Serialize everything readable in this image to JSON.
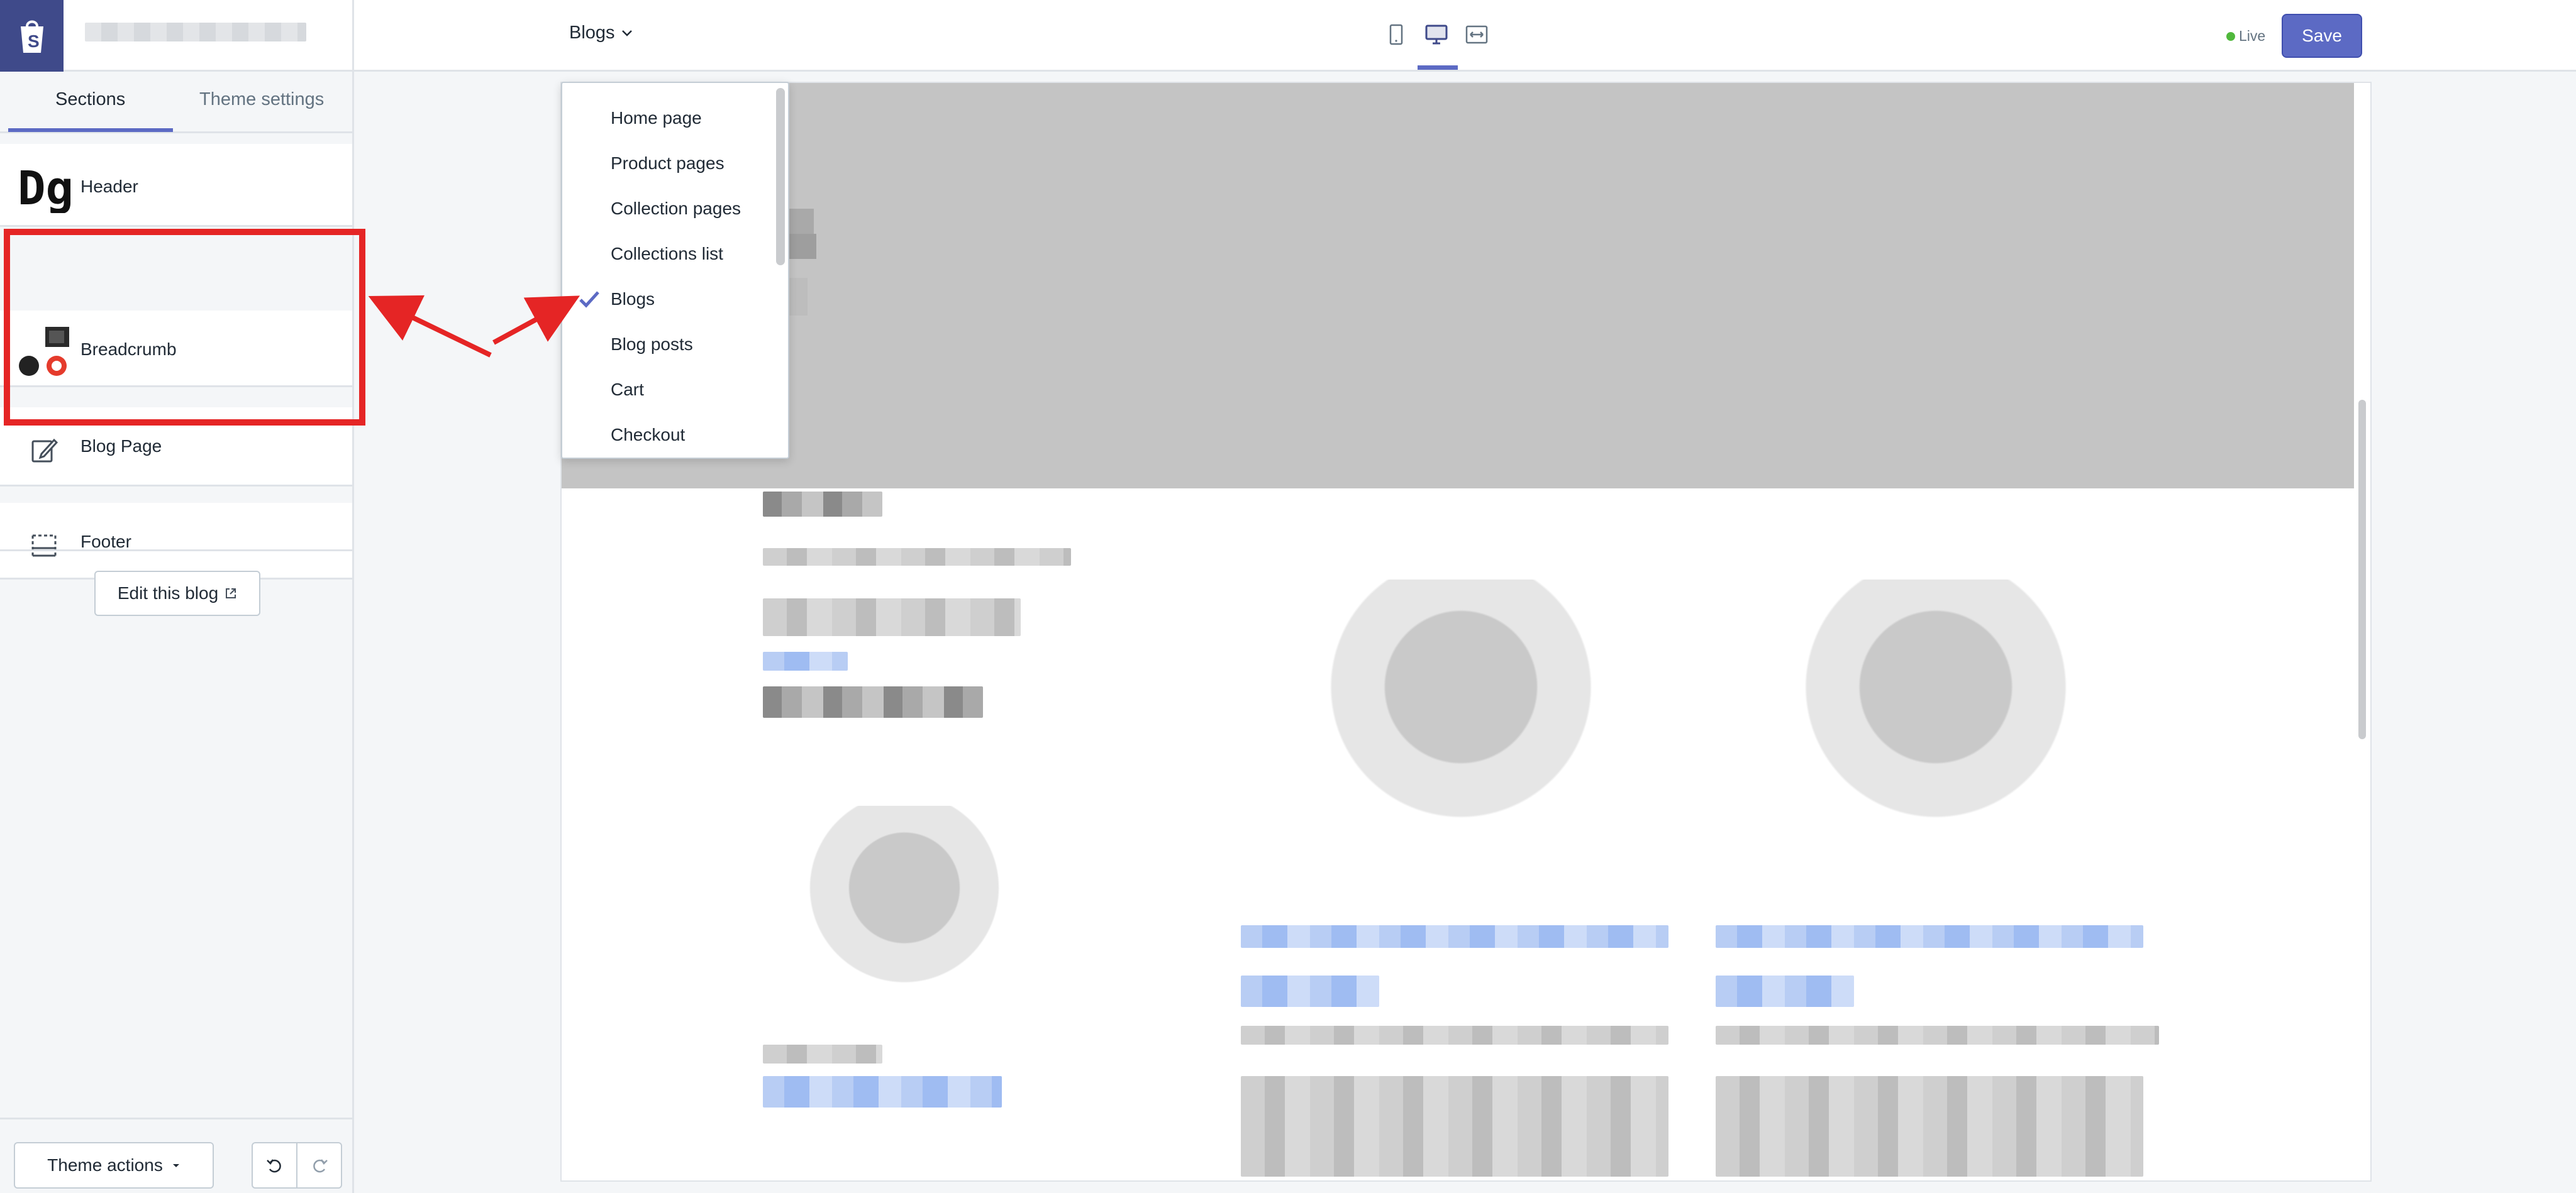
{
  "topbar": {
    "page_selector": "Blogs",
    "live_label": "Live",
    "save_label": "Save",
    "view_modes": [
      "mobile-view-icon",
      "desktop-view-icon",
      "fullscreen-view-icon"
    ],
    "active_view": "desktop"
  },
  "sidebar": {
    "tabs": [
      {
        "label": "Sections",
        "active": true
      },
      {
        "label": "Theme settings",
        "active": false
      }
    ],
    "sections": [
      {
        "label": "Header",
        "icon": "header-thumbnail"
      },
      {
        "label": "Breadcrumb",
        "icon": "breadcrumb-thumbnail"
      },
      {
        "label": "Blog Page",
        "icon": "edit-icon"
      },
      {
        "label": "Footer",
        "icon": "footer-icon"
      }
    ],
    "edit_button": "Edit this blog",
    "theme_actions": "Theme actions"
  },
  "dropdown": {
    "items": [
      {
        "label": "Home page",
        "checked": false
      },
      {
        "label": "Product pages",
        "checked": false
      },
      {
        "label": "Collection pages",
        "checked": false
      },
      {
        "label": "Collections list",
        "checked": false
      },
      {
        "label": "Blogs",
        "checked": true
      },
      {
        "label": "Blog posts",
        "checked": false
      },
      {
        "label": "Cart",
        "checked": false
      },
      {
        "label": "Checkout",
        "checked": false
      }
    ]
  },
  "colors": {
    "accent": "#5c6ac4",
    "annotation": "#e52525",
    "live": "#50b83c",
    "logo_bg": "#3f4a8a"
  }
}
